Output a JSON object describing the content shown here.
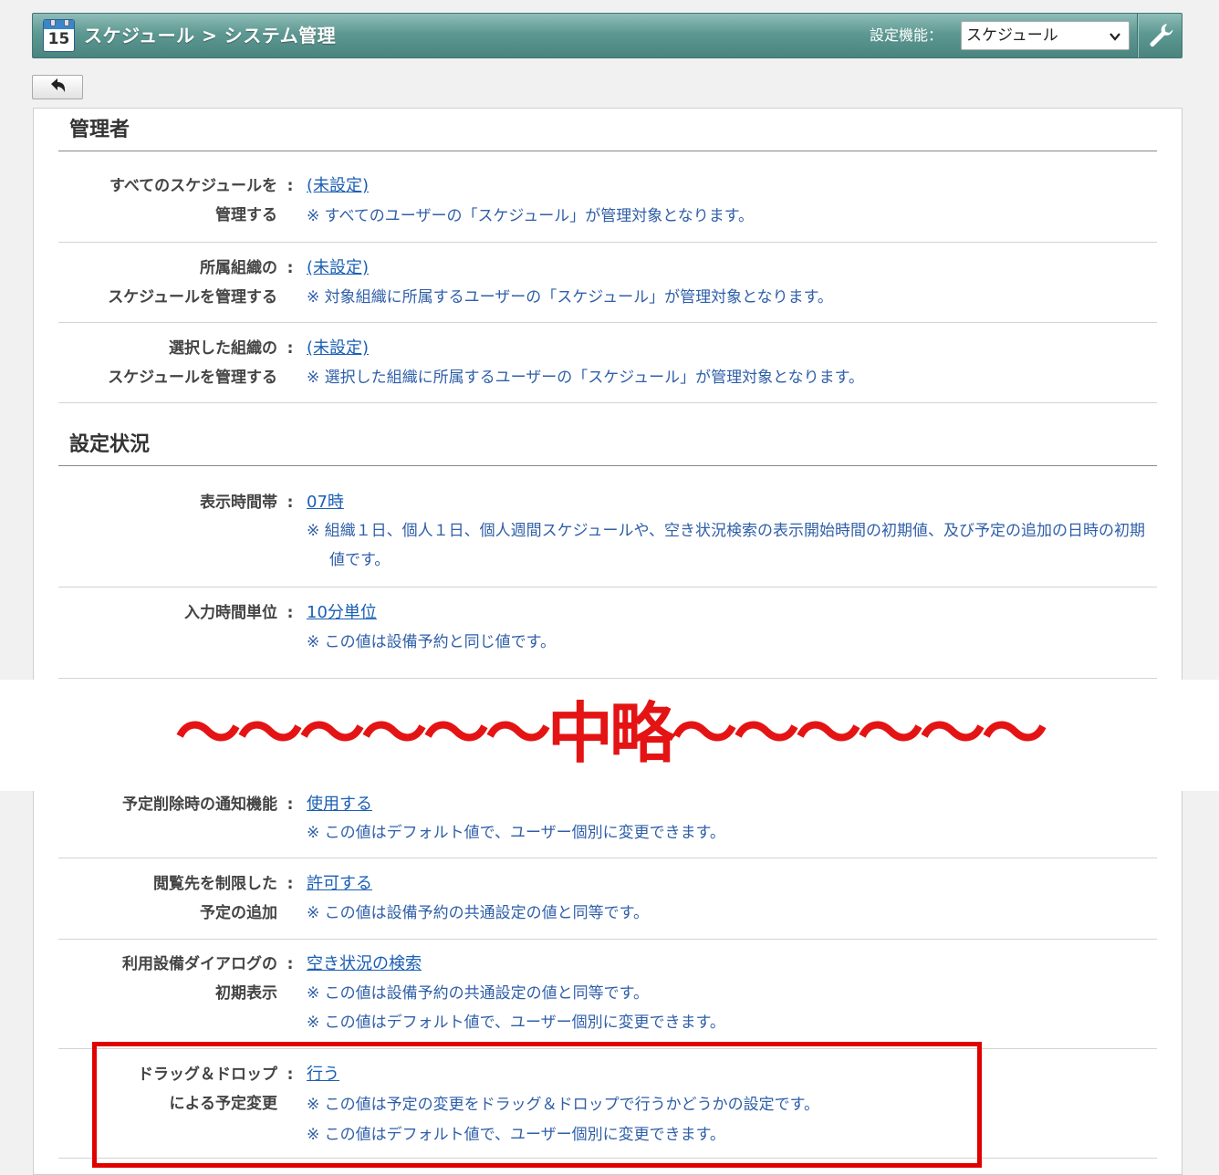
{
  "header": {
    "title": "スケジュール > システム管理",
    "calendar_number": "15",
    "settings_label": "設定機能：",
    "settings_select": "スケジュール"
  },
  "sections": {
    "admin": {
      "title": "管理者",
      "rows": [
        {
          "label1": "すべてのスケジュールを",
          "label2": "管理する",
          "value": "(未設定)",
          "note1": "※ すべてのユーザーの「スケジュール」が管理対象となります。"
        },
        {
          "label1": "所属組織の",
          "label2": "スケジュールを管理する",
          "value": "(未設定)",
          "note1": "※ 対象組織に所属するユーザーの「スケジュール」が管理対象となります。"
        },
        {
          "label1": "選択した組織の",
          "label2": "スケジュールを管理する",
          "value": "(未設定)",
          "note1": "※ 選択した組織に所属するユーザーの「スケジュール」が管理対象となります。"
        }
      ]
    },
    "status": {
      "title": "設定状況",
      "rows": [
        {
          "label1": "表示時間帯",
          "value": "07時",
          "note1": "※ 組織１日、個人１日、個人週間スケジュールや、空き状況検索の表示開始時間の初期値、及び予定の追加の日時の初期値です。"
        },
        {
          "label1": "入力時間単位",
          "value": "10分単位",
          "note1": "※ この値は設備予約と同じ値です。"
        }
      ]
    },
    "lower": {
      "rows": [
        {
          "label1": "予定削除時の通知機能",
          "value": "使用する",
          "note1": "※ この値はデフォルト値で、ユーザー個別に変更できます。"
        },
        {
          "label1": "閲覧先を制限した",
          "label2": "予定の追加",
          "value": "許可する",
          "note1": "※ この値は設備予約の共通設定の値と同等です。"
        },
        {
          "label1": "利用設備ダイアログの",
          "label2": "初期表示",
          "value": "空き状況の検索",
          "note1": "※ この値は設備予約の共通設定の値と同等です。",
          "note2": "※ この値はデフォルト値で、ユーザー個別に変更できます。"
        },
        {
          "label1": "ドラッグ＆ドロップ",
          "label2": "による予定変更",
          "value": "行う",
          "note1": "※ この値は予定の変更をドラッグ＆ドロップで行うかどうかの設定です。",
          "note2": "※ この値はデフォルト値で、ユーザー個別に変更できます。"
        }
      ]
    }
  },
  "omitted_banner": "〜〜〜〜〜〜中略〜〜〜〜〜〜",
  "colors": {
    "header_bg": "#5e9892",
    "link": "#1a5fb4",
    "note": "#2f5fa8",
    "highlight": "#e00000"
  },
  "icons": {
    "calendar": "calendar-icon",
    "settings": "wrench-icon",
    "back": "back-arrow-icon"
  }
}
